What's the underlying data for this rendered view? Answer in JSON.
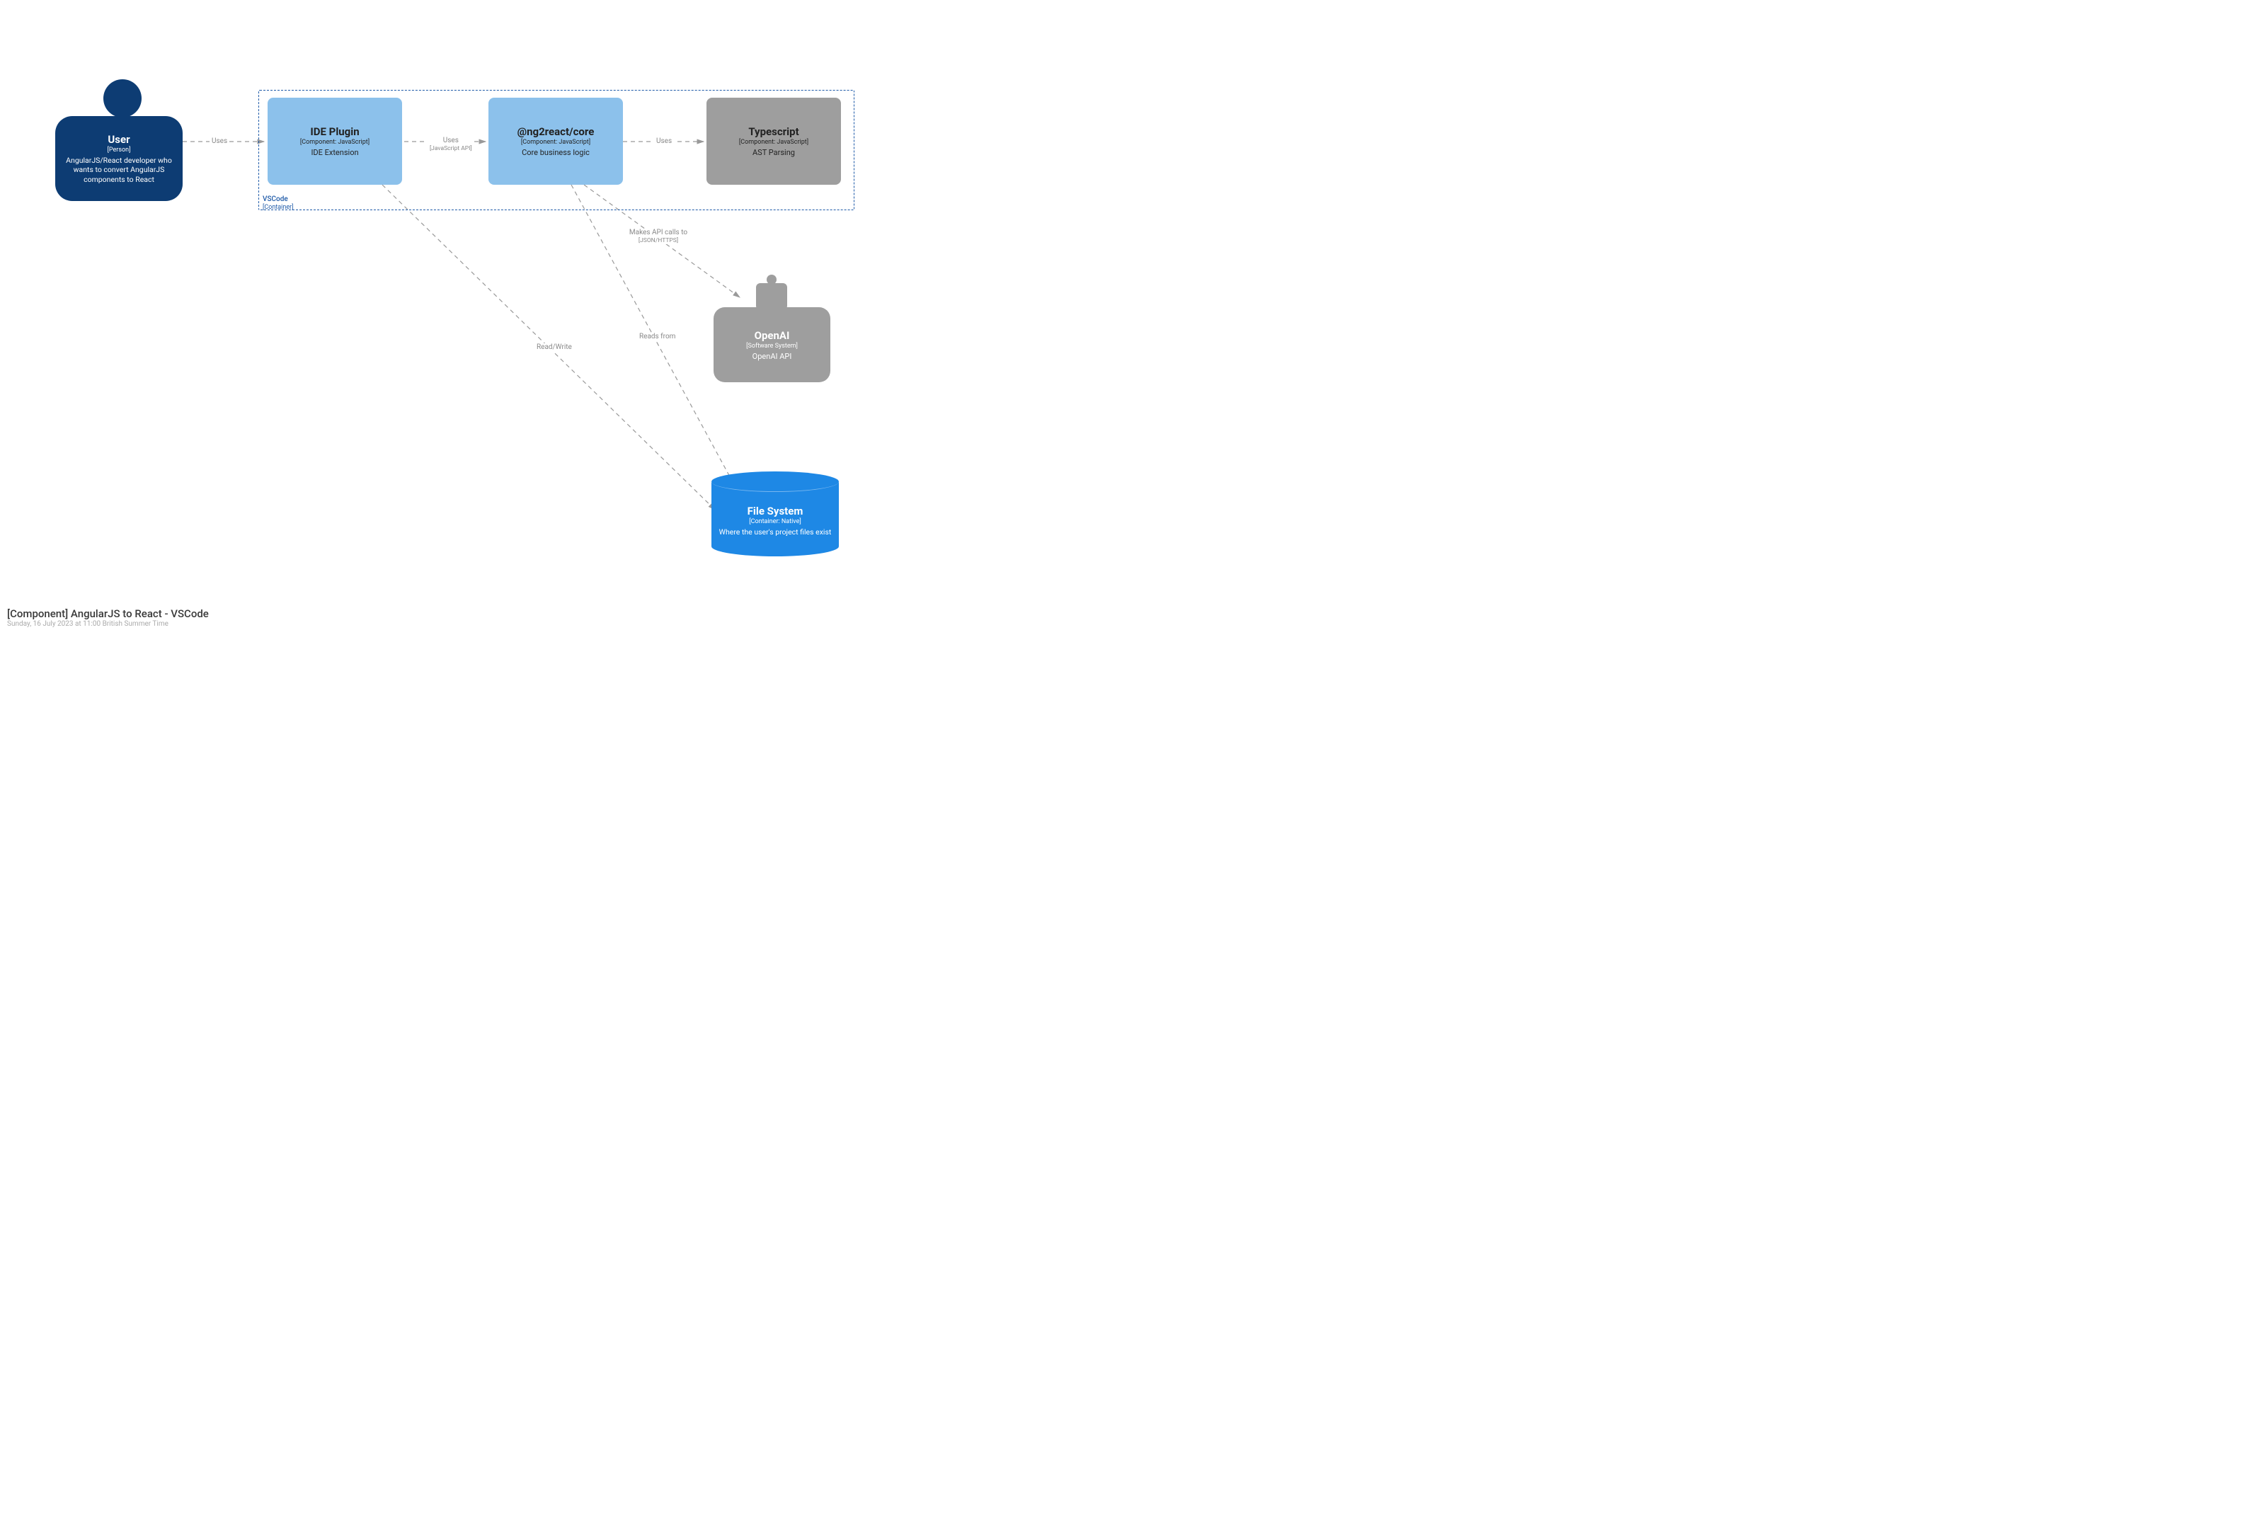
{
  "container": {
    "name": "VSCode",
    "meta": "[Container]"
  },
  "nodes": {
    "user": {
      "title": "User",
      "meta": "[Person]",
      "desc": "AngularJS/React developer who wants to convert AngularJS components to React"
    },
    "ide_plugin": {
      "title": "IDE Plugin",
      "meta": "[Component: JavaScript]",
      "desc": "IDE Extension"
    },
    "core": {
      "title": "@ng2react/core",
      "meta": "[Component: JavaScript]",
      "desc": "Core business logic"
    },
    "typescript": {
      "title": "Typescript",
      "meta": "[Component: JavaScript]",
      "desc": "AST Parsing"
    },
    "openai": {
      "title": "OpenAI",
      "meta": "[Software System]",
      "desc": "OpenAI API"
    },
    "file_system": {
      "title": "File System",
      "meta": "[Container: Native]",
      "desc": "Where the user's project files exist"
    }
  },
  "edges": {
    "user_ide": {
      "label": "Uses"
    },
    "ide_core": {
      "label": "Uses",
      "sub": "[JavaScript API]"
    },
    "core_ts": {
      "label": "Uses"
    },
    "core_openai": {
      "label": "Makes API calls to",
      "sub": "[JSON/HTTPS]"
    },
    "ide_fs": {
      "label": "Read/Write"
    },
    "core_fs": {
      "label": "Reads from"
    }
  },
  "footer": {
    "title": "[Component] AngularJS to React - VSCode",
    "sub": "Sunday, 16 July 2023 at 11:00 British Summer Time"
  }
}
